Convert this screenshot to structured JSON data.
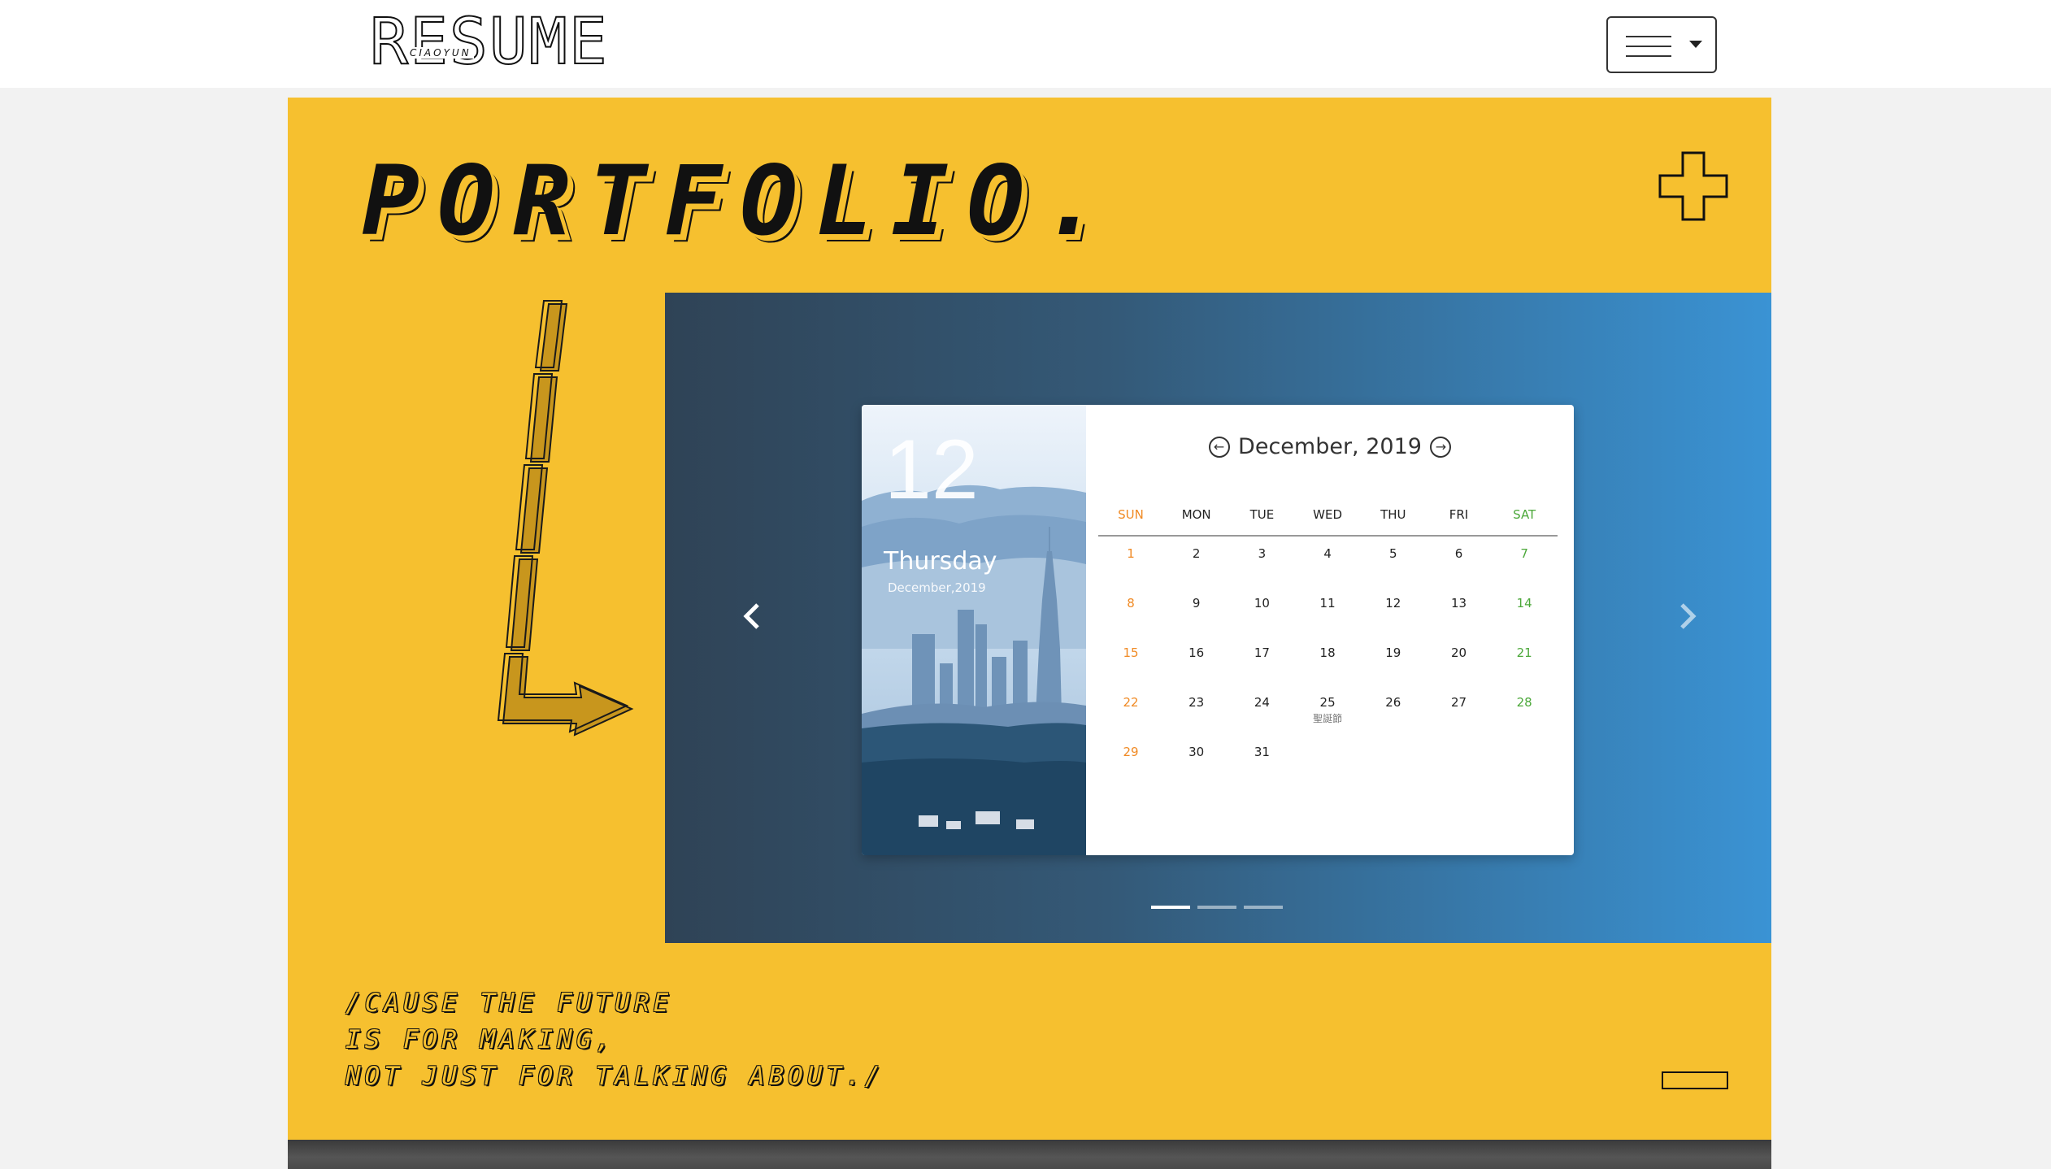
{
  "header": {
    "logo_text": "RESUME",
    "logo_subtext": "CIAOYUN",
    "menu_icon": "hamburger-icon",
    "menu_caret_icon": "caret-down-icon"
  },
  "portfolio": {
    "title": "PORTFOLIO.",
    "plus_icon": "plus-icon",
    "arrow_icon": "arrow-down-right-icon"
  },
  "carousel": {
    "prev_icon": "chevron-left-icon",
    "next_icon": "chevron-right-icon",
    "slide_count": 3,
    "active_slide": 1,
    "colors": {
      "gradient_start": "#2f4356",
      "gradient_end": "#3a93d4"
    }
  },
  "calendar": {
    "big_date": "12",
    "weekday": "Thursday",
    "month_year_sub": "December,2019",
    "header_title": "December, 2019",
    "prev_icon": "arrow-left-circle-icon",
    "next_icon": "arrow-right-circle-icon",
    "days_of_week": [
      "SUN",
      "MON",
      "TUE",
      "WED",
      "THU",
      "FRI",
      "SAT"
    ],
    "weeks": [
      [
        {
          "d": "1"
        },
        {
          "d": "2"
        },
        {
          "d": "3"
        },
        {
          "d": "4"
        },
        {
          "d": "5"
        },
        {
          "d": "6"
        },
        {
          "d": "7"
        }
      ],
      [
        {
          "d": "8"
        },
        {
          "d": "9"
        },
        {
          "d": "10"
        },
        {
          "d": "11"
        },
        {
          "d": "12"
        },
        {
          "d": "13"
        },
        {
          "d": "14"
        }
      ],
      [
        {
          "d": "15"
        },
        {
          "d": "16"
        },
        {
          "d": "17"
        },
        {
          "d": "18"
        },
        {
          "d": "19"
        },
        {
          "d": "20"
        },
        {
          "d": "21"
        }
      ],
      [
        {
          "d": "22"
        },
        {
          "d": "23"
        },
        {
          "d": "24"
        },
        {
          "d": "25",
          "note": "聖誕節"
        },
        {
          "d": "26"
        },
        {
          "d": "27"
        },
        {
          "d": "28"
        }
      ],
      [
        {
          "d": "29"
        },
        {
          "d": "30"
        },
        {
          "d": "31"
        }
      ]
    ],
    "colors": {
      "sunday": "#f08a24",
      "saturday": "#4ca83a"
    }
  },
  "quote": {
    "lines": [
      "/CAUSE THE FUTURE",
      "IS FOR MAKING,",
      "NOT JUST FOR TALKING ABOUT./"
    ]
  },
  "colors": {
    "panel": "#f6c02f",
    "page_bg": "#f2f2f2"
  }
}
